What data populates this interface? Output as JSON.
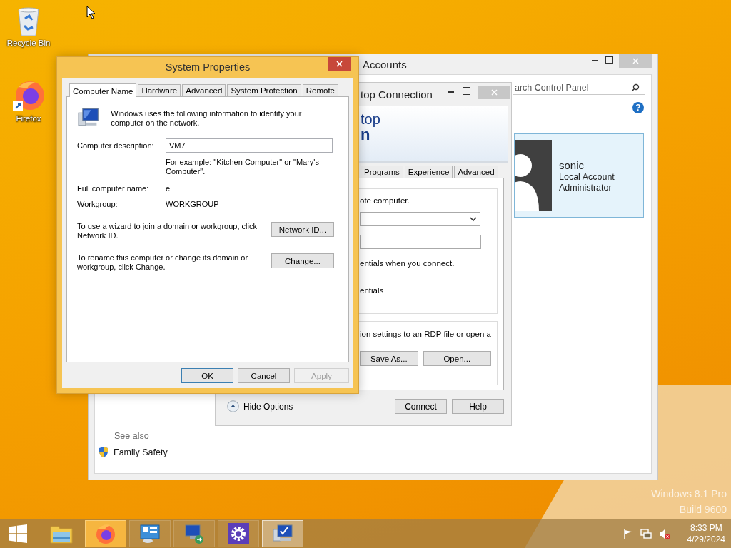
{
  "desktop_icons": [
    {
      "label": "Recycle Bin",
      "kind": "recycle-bin"
    },
    {
      "label": "Firefox",
      "kind": "firefox"
    }
  ],
  "control_panel": {
    "title": "Accounts",
    "search": {
      "placeholder": "arch Control Panel"
    },
    "help_label": "?",
    "account": {
      "name": "sonic",
      "type": "Local Account",
      "role": "Administrator"
    },
    "see_also": {
      "heading": "See also",
      "links": [
        "Family Safety"
      ]
    }
  },
  "remote_desktop": {
    "title": "top Connection",
    "banner": [
      "top",
      "n"
    ],
    "tabs": [
      {
        "label": "Programs",
        "selected": false
      },
      {
        "label": "Experience",
        "selected": false
      },
      {
        "label": "Advanced",
        "selected": false
      }
    ],
    "logon_text": "ote computer.",
    "credentials_text": "entials when you connect.",
    "credentials_text_2": "entials",
    "save_text": "ion settings to an RDP file or open a",
    "file_buttons": [
      "Save As...",
      "Open..."
    ],
    "hide_options": "Hide Options",
    "footer_buttons": [
      "Connect",
      "Help"
    ]
  },
  "system_properties": {
    "title": "System Properties",
    "tabs": [
      {
        "label": "Computer Name",
        "selected": true
      },
      {
        "label": "Hardware",
        "selected": false
      },
      {
        "label": "Advanced",
        "selected": false
      },
      {
        "label": "System Protection",
        "selected": false
      },
      {
        "label": "Remote",
        "selected": false
      }
    ],
    "intro": "Windows uses the following information to identify your computer on the network.",
    "description": {
      "label": "Computer description:",
      "value": "VM7"
    },
    "example": "For example: \"Kitchen Computer\" or \"Mary's Computer\".",
    "fields": [
      {
        "label": "Full computer name:",
        "value": "e"
      },
      {
        "label": "Workgroup:",
        "value": "WORKGROUP"
      }
    ],
    "actions": [
      {
        "text": "To use a wizard to join a domain or workgroup, click Network ID.",
        "button": "Network ID..."
      },
      {
        "text": "To rename this computer or change its domain or workgroup, click Change.",
        "button": "Change..."
      }
    ],
    "buttons": [
      {
        "label": "OK",
        "default": true,
        "disabled": false
      },
      {
        "label": "Cancel",
        "default": false,
        "disabled": false
      },
      {
        "label": "Apply",
        "default": false,
        "disabled": true
      }
    ]
  },
  "watermark": [
    "Windows 8.1 Pro",
    "Build 9600"
  ],
  "taskbar": {
    "apps": [
      {
        "kind": "explorer",
        "selected": false,
        "hovered": false
      },
      {
        "kind": "firefox",
        "selected": false,
        "hovered": true
      },
      {
        "kind": "control-panel",
        "selected": false,
        "hovered": false
      },
      {
        "kind": "remote-desktop",
        "selected": false,
        "hovered": false
      },
      {
        "kind": "settings",
        "selected": false,
        "hovered": false
      },
      {
        "kind": "system",
        "selected": true,
        "hovered": false
      }
    ],
    "clock": {
      "time": "8:33 PM",
      "date": "4/29/2024"
    }
  }
}
